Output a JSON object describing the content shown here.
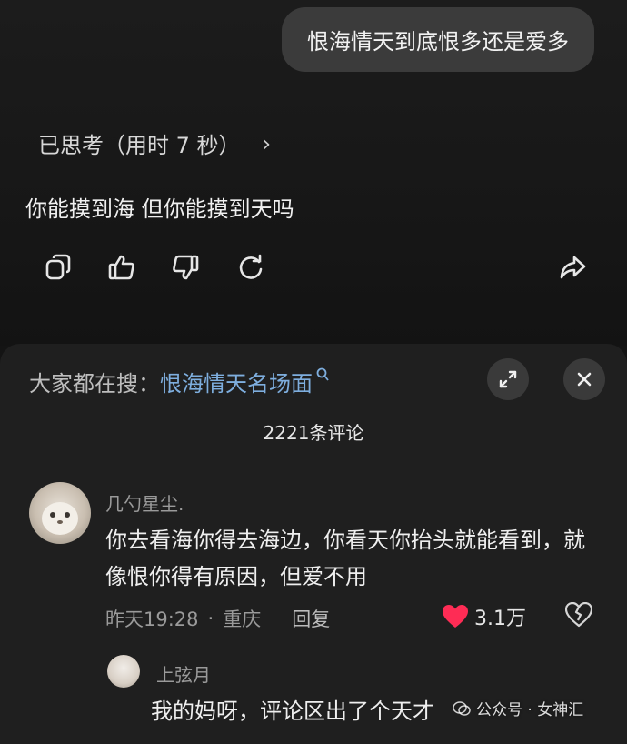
{
  "chat": {
    "user_message": "恨海情天到底恨多还是爱多",
    "thought_label": "已思考（用时 7 秒）",
    "thought_chevron": "›",
    "answer": "你能摸到海 但你能摸到天吗",
    "actions": [
      "copy-icon",
      "thumbs-up-icon",
      "thumbs-down-icon",
      "regenerate-icon",
      "share-icon"
    ]
  },
  "comments_sheet": {
    "search_prefix": "大家都在搜：",
    "search_link": "恨海情天名场面",
    "comment_count": "2221条评论",
    "comments": [
      {
        "user": "几勺星尘.",
        "text": "你去看海你得去海边，你看天你抬头就能看到，就像恨你得有原因，但爱不用",
        "time": "昨天19:28",
        "separator": "·",
        "location": "重庆",
        "reply_label": "回复",
        "likes": "3.1万",
        "liked": true
      }
    ],
    "reply": {
      "user": "上弦月",
      "text": "我的妈呀，评论区出了个天才"
    }
  },
  "watermark": "公众号 · 女神汇",
  "colors": {
    "background": "#141414",
    "sheet": "#1f1f1f",
    "link": "#7eaede",
    "like_heart": "#fe2c55",
    "muted": "#9a9a9a"
  }
}
